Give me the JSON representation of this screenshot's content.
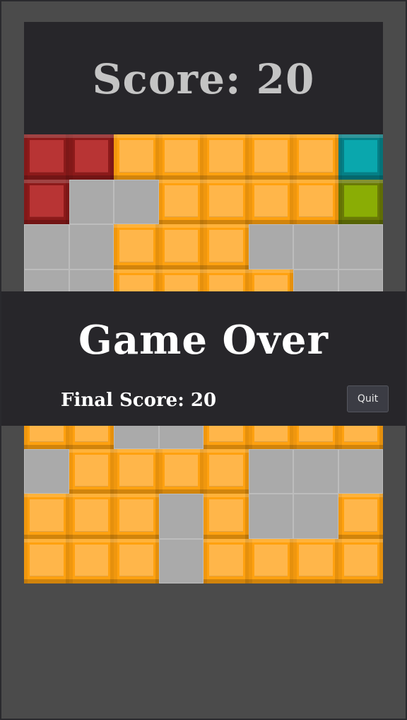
{
  "game": {
    "score_label": "Score: 20",
    "over_title": "Game Over",
    "final_score_label": "Final Score: 20",
    "quit_label": "Quit"
  },
  "colors": {
    "background": "#4b4b4b",
    "panel": "#27262a",
    "empty": "#aaaaaa",
    "O": {
      "base": "#ffa10f",
      "inner": "#ffb64a"
    },
    "R": {
      "base": "#8c1a1a",
      "inner": "#b83434"
    },
    "T": {
      "base": "#057f86",
      "inner": "#0aa7ad"
    },
    "G": {
      "base": "#6a7a06",
      "inner": "#8aad05"
    }
  },
  "board": {
    "rows": [
      "RROOOOOT",
      "R..OOOOG",
      "..OOO...",
      "..OOOO..",
      "........",
      "........",
      "OO..OOOO",
      ".OOOO...",
      "OOO.O..O",
      "OOO.OOOO"
    ]
  }
}
